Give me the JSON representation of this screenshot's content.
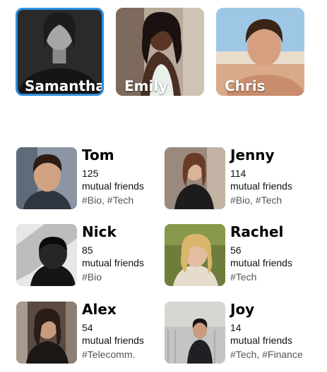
{
  "stories": [
    {
      "name": "Samantha",
      "selected": true
    },
    {
      "name": "Emily",
      "selected": false
    },
    {
      "name": "Chris",
      "selected": false
    }
  ],
  "friends": [
    {
      "name": "Tom",
      "count": "125",
      "mutual_label": "mutual friends",
      "tags": "#Bio, #Tech"
    },
    {
      "name": "Jenny",
      "count": "114",
      "mutual_label": "mutual friends",
      "tags": "#Bio, #Tech"
    },
    {
      "name": "Nick",
      "count": "85",
      "mutual_label": "mutual friends",
      "tags": "#Bio"
    },
    {
      "name": "Rachel",
      "count": "56",
      "mutual_label": "mutual friends",
      "tags": "#Tech"
    },
    {
      "name": "Alex",
      "count": "54",
      "mutual_label": "mutual friends",
      "tags": "#Telecomm."
    },
    {
      "name": "Joy",
      "count": "14",
      "mutual_label": "mutual friends",
      "tags": "#Tech, #Finance"
    }
  ],
  "colors": {
    "selected_border": "#2d8fe0",
    "tag_text": "#555555"
  }
}
